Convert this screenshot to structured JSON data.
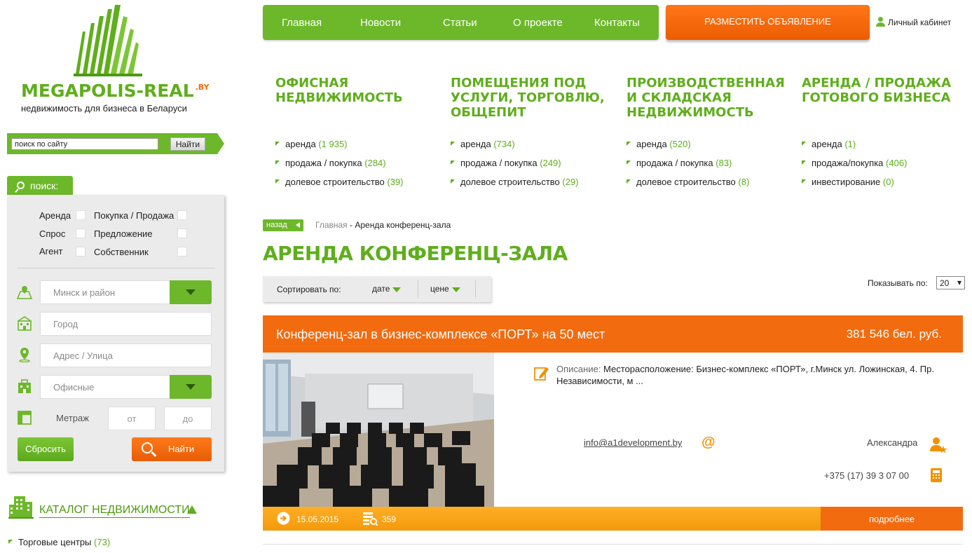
{
  "logo": {
    "name": "MEGAPOLIS-REAL",
    "tld": ".BY",
    "tagline": "недвижимость для бизнеса в Беларуси"
  },
  "site_search": {
    "placeholder": "поиск по сайту",
    "button": "Найти"
  },
  "topnav": {
    "items": [
      "Главная",
      "Новости",
      "Статьи",
      "О проекте",
      "Контакты"
    ]
  },
  "post_ad_button": "РАЗМЕСТИТЬ ОБЪЯВЛЕНИЕ",
  "cabinet_link": "Личный кабинет",
  "search_panel": {
    "tab": "поиск:",
    "checkboxes": [
      "Аренда",
      "Покупка / Продажа",
      "Спрос",
      "Предложение",
      "Агент",
      "Собственник"
    ],
    "region": "Минск и район",
    "city_placeholder": "Город",
    "address_placeholder": "Адрес / Улица",
    "type": "Офисные",
    "area_label": "Метраж",
    "from_placeholder": "от",
    "to_placeholder": "до",
    "reset_button": "Сбросить",
    "find_button": "Найти"
  },
  "catalog": {
    "title": "КАТАЛОГ НЕДВИЖИМОСТИ",
    "items": [
      {
        "label": "Торговые центры",
        "count": "(73)"
      }
    ]
  },
  "categories": [
    {
      "title": "ОФИСНАЯ НЕДВИЖИМОСТЬ",
      "links": [
        {
          "label": "аренда",
          "count": "(1 935)"
        },
        {
          "label": "продажа / покупка",
          "count": "(284)"
        },
        {
          "label": "долевое строительство",
          "count": "(39)"
        }
      ]
    },
    {
      "title": "ПОМЕЩЕНИЯ ПОД УСЛУГИ, ТОРГОВЛЮ, ОБЩЕПИТ",
      "links": [
        {
          "label": "аренда",
          "count": "(734)"
        },
        {
          "label": "продажа / покупка",
          "count": "(249)"
        },
        {
          "label": "долевое строительство",
          "count": "(29)"
        }
      ]
    },
    {
      "title": "ПРОИЗВОДСТВЕННАЯ И СКЛАДСКАЯ НЕДВИЖИМОСТЬ",
      "links": [
        {
          "label": "аренда",
          "count": "(520)"
        },
        {
          "label": "продажа / покупка",
          "count": "(83)"
        },
        {
          "label": "долевое строительство",
          "count": "(8)"
        }
      ]
    },
    {
      "title": "АРЕНДА / ПРОДАЖА ГОТОВОГО БИЗНЕСА",
      "links": [
        {
          "label": "аренда",
          "count": "(1)"
        },
        {
          "label": "продажа/покупка",
          "count": "(406)"
        },
        {
          "label": "инвестирование",
          "count": "(0)"
        }
      ]
    }
  ],
  "breadcrumb": {
    "back": "назад",
    "home": "Главная",
    "separator": " - ",
    "current": "Аренда конференц-зала"
  },
  "page_title": "АРЕНДА КОНФЕРЕНЦ-ЗАЛА",
  "sort": {
    "label": "Сортировать по:",
    "options": [
      "дате",
      "цене"
    ]
  },
  "per_page": {
    "label": "Показывать по:",
    "value": "20"
  },
  "listing": {
    "title": "Конференц-зал в бизнес-комплексе «ПОРТ» на 50 мест",
    "price": "381 546 бел. руб.",
    "description_label": "Описание:",
    "description": " Месторасположение: Бизнес-комплекс «ПОРТ», г.Минск ул. Ложинская, 4. Пр. Независимости, м ...",
    "email": "info@a1development.by",
    "contact_name": "Александра",
    "phone": "+375 (17) 39 3 07 00",
    "date": "15.05.2015",
    "views": "359",
    "more_button": "подробнее"
  },
  "colors": {
    "green": "#6db82a",
    "green_text": "#5fae1c",
    "orange": "#f26b0f",
    "orange_light": "#ffae26"
  }
}
